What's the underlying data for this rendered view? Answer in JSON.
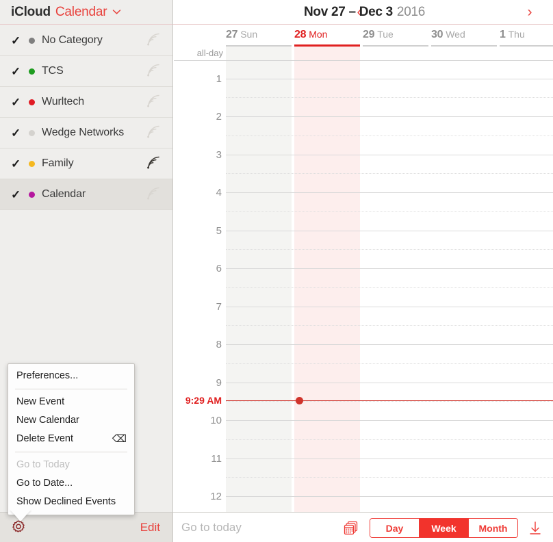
{
  "sidebar": {
    "account": {
      "provider": "iCloud",
      "calendar_label": "Calendar",
      "chevron": "chevron-down-icon"
    },
    "calendars": [
      {
        "name": "No Category",
        "color": "#7f7f7f",
        "checked": "✓",
        "selected": false,
        "shared": false
      },
      {
        "name": "TCS",
        "color": "#1f9c20",
        "checked": "✓",
        "selected": false,
        "shared": false
      },
      {
        "name": "Wurltech",
        "color": "#e01b24",
        "checked": "✓",
        "selected": false,
        "shared": false
      },
      {
        "name": "Wedge Networks",
        "color": "#d4d2ce",
        "checked": "✓",
        "selected": false,
        "shared": false
      },
      {
        "name": "Family",
        "color": "#f5b820",
        "checked": "✓",
        "selected": false,
        "shared": true
      },
      {
        "name": "Calendar",
        "color": "#b5179e",
        "checked": "✓",
        "selected": true,
        "shared": false
      }
    ],
    "footer": {
      "gear": "gear-icon",
      "edit_label": "Edit"
    }
  },
  "context_menu": {
    "items": [
      {
        "label": "Preferences...",
        "disabled": false,
        "separator_after": true,
        "shortcut": ""
      },
      {
        "label": "New Event",
        "disabled": false,
        "separator_after": false,
        "shortcut": ""
      },
      {
        "label": "New Calendar",
        "disabled": false,
        "separator_after": false,
        "shortcut": ""
      },
      {
        "label": "Delete Event",
        "disabled": false,
        "separator_after": true,
        "shortcut": "⌫"
      },
      {
        "label": "Go to Today",
        "disabled": true,
        "separator_after": false,
        "shortcut": ""
      },
      {
        "label": "Go to Date...",
        "disabled": false,
        "separator_after": false,
        "shortcut": ""
      },
      {
        "label": "Show Declined Events",
        "disabled": false,
        "separator_after": false,
        "shortcut": ""
      }
    ]
  },
  "header": {
    "range": "Nov 27 – Dec 3",
    "year": "2016",
    "prev_icon": "‹",
    "next_icon": "›"
  },
  "calendar": {
    "allday_label": "all-day",
    "days": [
      {
        "num": "27",
        "name": "Sun",
        "today": false,
        "weekend": true
      },
      {
        "num": "28",
        "name": "Mon",
        "today": true,
        "weekend": false
      },
      {
        "num": "29",
        "name": "Tue",
        "today": false,
        "weekend": false
      },
      {
        "num": "30",
        "name": "Wed",
        "today": false,
        "weekend": false
      },
      {
        "num": "1",
        "name": "Thu",
        "today": false,
        "weekend": false
      }
    ],
    "hours": [
      "1",
      "2",
      "3",
      "4",
      "5",
      "6",
      "7",
      "8",
      "9",
      "10",
      "11",
      "12"
    ],
    "now": {
      "label": "9:29 AM",
      "hour": 9,
      "minute": 29
    },
    "colors": {
      "today_tint": "#fdeeed",
      "weekend_tint": "#f4f4f2",
      "weekday": "#ffffff",
      "today_accent": "#e02020",
      "now_line": "#d0342c"
    }
  },
  "toolbar": {
    "goto_today_placeholder": "Go to today",
    "multical_icon": "multi-calendar-icon",
    "download_icon": "download-icon",
    "views": [
      {
        "label": "Day",
        "active": false
      },
      {
        "label": "Week",
        "active": true
      },
      {
        "label": "Month",
        "active": false
      }
    ]
  }
}
